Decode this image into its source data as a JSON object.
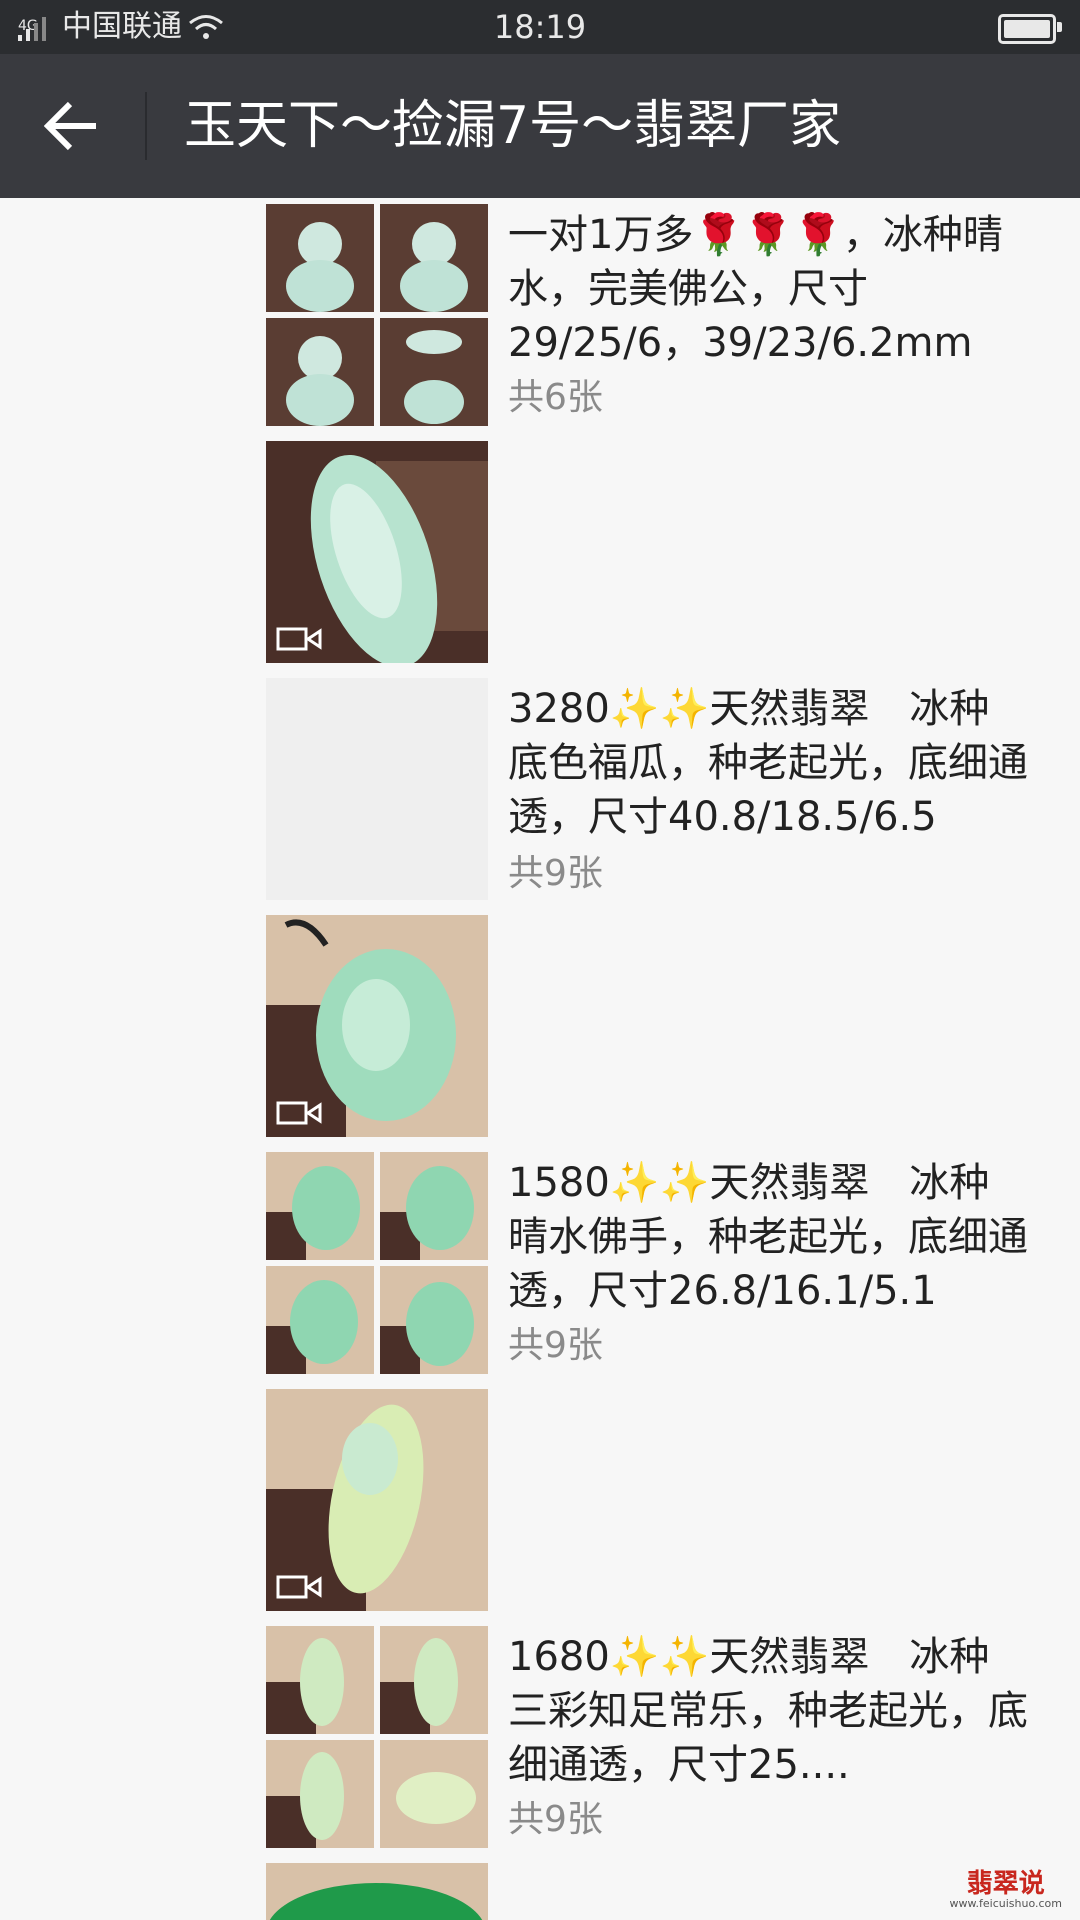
{
  "status": {
    "network": "4G",
    "carrier": "中国联通",
    "time": "18:19"
  },
  "header": {
    "title": "玉天下～捡漏7号～翡翠厂家"
  },
  "posts": [
    {
      "type": "grid",
      "caption": "一对1万多🌹🌹🌹，冰种晴水，完美佛公，尺寸29/25/6，39/23/6.2mm",
      "count": "共6张"
    },
    {
      "type": "video"
    },
    {
      "type": "empty",
      "caption": "3280✨✨天然翡翠　冰种底色福瓜，种老起光，底细通透，尺寸40.8/18.5/6.5",
      "count": "共9张"
    },
    {
      "type": "video"
    },
    {
      "type": "grid",
      "caption": "1580✨✨天然翡翠　冰种晴水佛手，种老起光，底细通透，尺寸26.8/16.1/5.1",
      "count": "共9张"
    },
    {
      "type": "video"
    },
    {
      "type": "grid",
      "caption": "1680✨✨天然翡翠　冰种三彩知足常乐，种老起光，底细通透，尺寸25....",
      "count": "共9张"
    },
    {
      "type": "partial"
    }
  ],
  "watermark": {
    "text": "翡翠说",
    "url": "www.feicuishuo.com"
  },
  "colors": {
    "statusbar": "#2b2d30",
    "navbar": "#393a3f",
    "background": "#f7f7f7",
    "count_text": "#8a8a8a"
  }
}
